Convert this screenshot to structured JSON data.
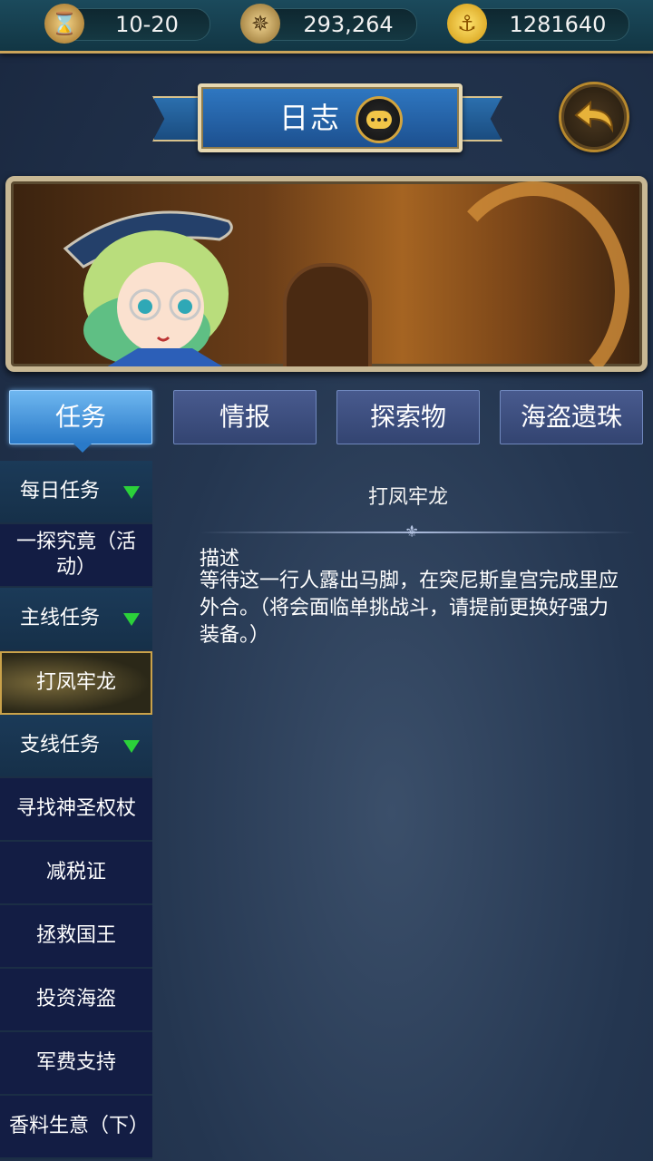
{
  "resources": {
    "time": {
      "icon": "hourglass-icon",
      "value": "10-20"
    },
    "compass": {
      "icon": "compass-icon",
      "value": "293,264"
    },
    "gold": {
      "icon": "anchor-coin-icon",
      "value": "1281640"
    }
  },
  "header": {
    "title": "日志",
    "chat_icon": "chat-bubble-icon",
    "back_icon": "back-arrow-icon"
  },
  "tabs": [
    {
      "label": "任务",
      "active": true
    },
    {
      "label": "情报",
      "active": false
    },
    {
      "label": "探索物",
      "active": false
    },
    {
      "label": "海盗遗珠",
      "active": false
    }
  ],
  "sidebar": {
    "items": [
      {
        "label": "每日任务",
        "type": "category"
      },
      {
        "label": "一探究竟（活动）",
        "type": "entry"
      },
      {
        "label": "主线任务",
        "type": "category"
      },
      {
        "label": "打凤牢龙",
        "type": "entry",
        "selected": true
      },
      {
        "label": "支线任务",
        "type": "category"
      },
      {
        "label": "寻找神圣权杖",
        "type": "entry"
      },
      {
        "label": "减税证",
        "type": "entry"
      },
      {
        "label": "拯救国王",
        "type": "entry"
      },
      {
        "label": "投资海盗",
        "type": "entry"
      },
      {
        "label": "军费支持",
        "type": "entry"
      },
      {
        "label": "香料生意（下）",
        "type": "entry"
      }
    ]
  },
  "quest": {
    "title": "打凤牢龙",
    "desc_label": "描述",
    "desc_text": "等待这一行人露出马脚，在突尼斯皇宫完成里应外合。（将会面临单挑战斗，请提前更换好强力装备。）"
  }
}
